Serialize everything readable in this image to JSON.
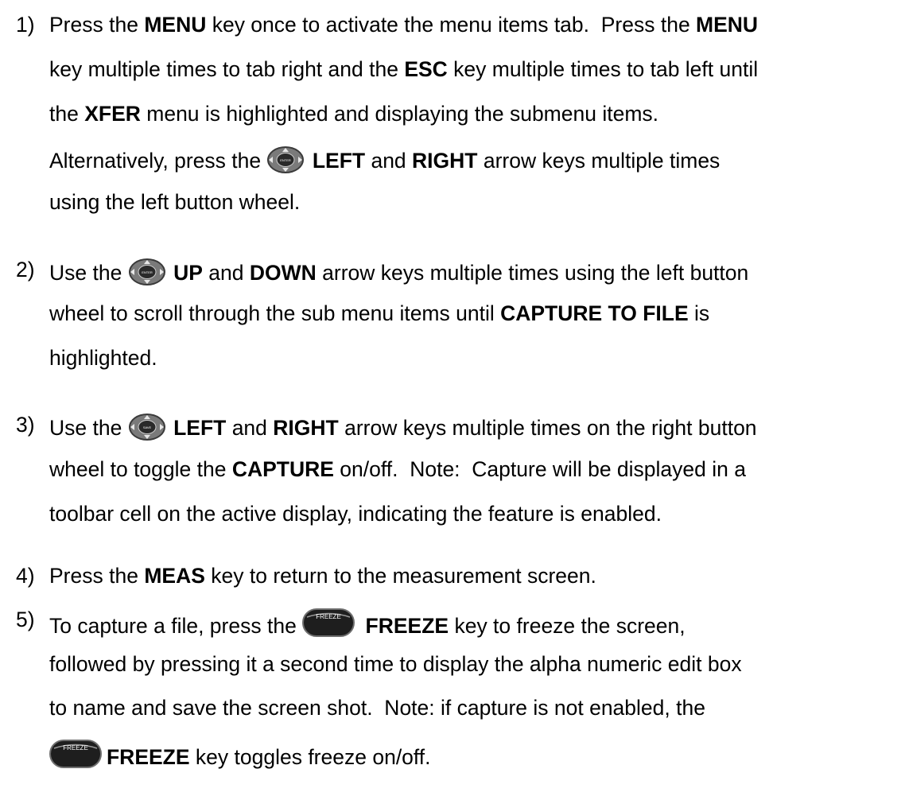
{
  "steps": [
    {
      "num": "1)",
      "lines": [
        [
          {
            "t": "Press the "
          },
          {
            "t": "MENU",
            "b": true
          },
          {
            "t": " key once to activate the menu items tab.  Press the "
          },
          {
            "t": "MENU",
            "b": true
          }
        ],
        [
          {
            "t": "key multiple times to tab right and the "
          },
          {
            "t": "ESC",
            "b": true
          },
          {
            "t": " key multiple times to tab left until"
          }
        ],
        [
          {
            "t": "the "
          },
          {
            "t": "XFER",
            "b": true
          },
          {
            "t": " menu is highlighted and displaying the submenu items."
          }
        ],
        [
          {
            "t": "Alternatively, press the "
          },
          {
            "icon": "wheel-enter"
          },
          {
            "t": " "
          },
          {
            "t": "LEFT",
            "b": true
          },
          {
            "t": " and "
          },
          {
            "t": "RIGHT",
            "b": true
          },
          {
            "t": " arrow keys multiple times"
          }
        ],
        [
          {
            "t": "using the left button wheel."
          }
        ]
      ]
    },
    {
      "num": "2)",
      "lines": [
        [
          {
            "t": "Use the "
          },
          {
            "icon": "wheel-enter"
          },
          {
            "t": " "
          },
          {
            "t": "UP",
            "b": true
          },
          {
            "t": " and "
          },
          {
            "t": "DOWN",
            "b": true
          },
          {
            "t": " arrow keys multiple times using the left button"
          }
        ],
        [
          {
            "t": "wheel to scroll through the sub menu items until "
          },
          {
            "t": "CAPTURE TO FILE",
            "b": true
          },
          {
            "t": " is"
          }
        ],
        [
          {
            "t": "highlighted."
          }
        ]
      ]
    },
    {
      "num": "3)",
      "lines": [
        [
          {
            "t": "Use the "
          },
          {
            "icon": "wheel-right"
          },
          {
            "t": " "
          },
          {
            "t": "LEFT",
            "b": true
          },
          {
            "t": " and "
          },
          {
            "t": "RIGHT",
            "b": true
          },
          {
            "t": " arrow keys multiple times on the right button"
          }
        ],
        [
          {
            "t": "wheel to toggle the "
          },
          {
            "t": "CAPTURE",
            "b": true
          },
          {
            "t": " on/off.  Note:  Capture will be displayed in a"
          }
        ],
        [
          {
            "t": "toolbar cell on the active display, indicating the feature is enabled."
          }
        ]
      ]
    },
    {
      "num": "4)",
      "lines": [
        [
          {
            "t": "Press the "
          },
          {
            "t": "MEAS",
            "b": true
          },
          {
            "t": " key to return to the measurement screen."
          }
        ]
      ]
    },
    {
      "num": "5)",
      "lines": [
        [
          {
            "t": "To capture a file, press the "
          },
          {
            "icon": "freeze-key"
          },
          {
            "t": " "
          },
          {
            "t": "FREEZE",
            "b": true
          },
          {
            "t": " key to freeze the screen,"
          }
        ],
        [
          {
            "t": "followed by pressing it a second time to display the alpha numeric edit box"
          }
        ],
        [
          {
            "t": "to name and save the screen shot.  Note: if capture is not enabled, the"
          }
        ],
        [
          {
            "icon": "freeze-key"
          },
          {
            "t": "FREEZE",
            "b": true
          },
          {
            "t": " key toggles freeze on/off."
          }
        ]
      ]
    }
  ],
  "icons": {
    "wheel-enter": {
      "name": "enter-wheel-icon",
      "center_label": "ENTER"
    },
    "wheel-right": {
      "name": "right-wheel-icon",
      "center_label": "SAVE"
    },
    "freeze-key": {
      "name": "freeze-key-icon",
      "label": "FREEZE"
    }
  }
}
